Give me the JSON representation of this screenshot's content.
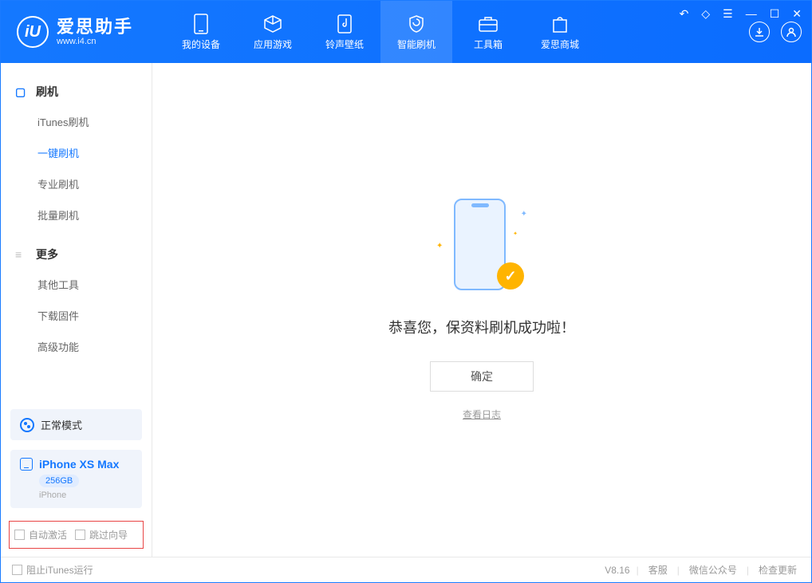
{
  "app": {
    "name": "爱思助手",
    "url": "www.i4.cn"
  },
  "nav": {
    "tabs": [
      {
        "label": "我的设备"
      },
      {
        "label": "应用游戏"
      },
      {
        "label": "铃声壁纸"
      },
      {
        "label": "智能刷机"
      },
      {
        "label": "工具箱"
      },
      {
        "label": "爱思商城"
      }
    ]
  },
  "sidebar": {
    "group1_title": "刷机",
    "group1_items": [
      "iTunes刷机",
      "一键刷机",
      "专业刷机",
      "批量刷机"
    ],
    "group2_title": "更多",
    "group2_items": [
      "其他工具",
      "下载固件",
      "高级功能"
    ],
    "mode_label": "正常模式",
    "device": {
      "name": "iPhone XS Max",
      "storage": "256GB",
      "type": "iPhone"
    },
    "checkbox1": "自动激活",
    "checkbox2": "跳过向导"
  },
  "main": {
    "success_msg": "恭喜您，保资料刷机成功啦！",
    "confirm_btn": "确定",
    "view_log": "查看日志"
  },
  "footer": {
    "block_itunes": "阻止iTunes运行",
    "version": "V8.16",
    "link1": "客服",
    "link2": "微信公众号",
    "link3": "检查更新"
  }
}
